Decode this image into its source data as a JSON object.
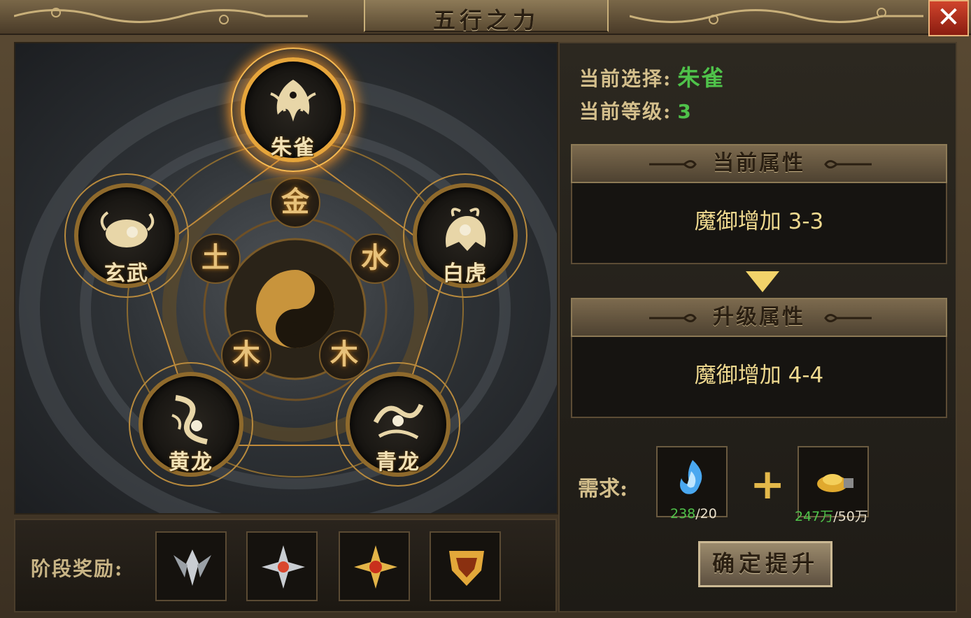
{
  "window": {
    "title": "五行之力",
    "close_icon": "close-icon"
  },
  "beasts": [
    {
      "key": "zhuque",
      "label": "朱雀",
      "icon": "phoenix-icon",
      "selected": true
    },
    {
      "key": "baihu",
      "label": "白虎",
      "icon": "tiger-icon",
      "selected": false
    },
    {
      "key": "qinglong",
      "label": "青龙",
      "icon": "azure-dragon-icon",
      "selected": false
    },
    {
      "key": "huanglong",
      "label": "黄龙",
      "icon": "yellow-dragon-icon",
      "selected": false
    },
    {
      "key": "xuanwu",
      "label": "玄武",
      "icon": "tortoise-icon",
      "selected": false
    }
  ],
  "elements": [
    {
      "glyph": "金",
      "icon": "metal-element-icon"
    },
    {
      "glyph": "水",
      "icon": "water-element-icon"
    },
    {
      "glyph": "木",
      "icon": "wood-element-icon"
    },
    {
      "glyph": "木",
      "icon": "wood-element-icon"
    },
    {
      "glyph": "土",
      "icon": "earth-element-icon"
    }
  ],
  "center_icon": "yin-yang-icon",
  "rewards": {
    "label": "阶段奖励:",
    "items": [
      {
        "icon": "silver-wings-badge-icon"
      },
      {
        "icon": "silver-star-badge-icon"
      },
      {
        "icon": "gold-star-badge-icon"
      },
      {
        "icon": "gold-crest-badge-icon"
      }
    ]
  },
  "info": {
    "selection_label": "当前选择:",
    "selection_value": "朱雀",
    "level_label": "当前等级:",
    "level_value": "3"
  },
  "current_attr": {
    "header": "当前属性",
    "text": "魔御增加 3-3"
  },
  "upgrade_attr": {
    "header": "升级属性",
    "text": "魔御增加 4-4"
  },
  "requirements": {
    "label": "需求:",
    "items": [
      {
        "icon": "blue-flame-crystal-icon",
        "have": "238",
        "need": "/20"
      },
      {
        "icon": "gold-ingot-icon",
        "have": "247万",
        "need": "/50万"
      }
    ],
    "plus": "+"
  },
  "confirm_button": "确定提升",
  "colors": {
    "accent_gold": "#e6a53b",
    "value_green": "#4fc24a",
    "attr_text": "#efd98f"
  }
}
